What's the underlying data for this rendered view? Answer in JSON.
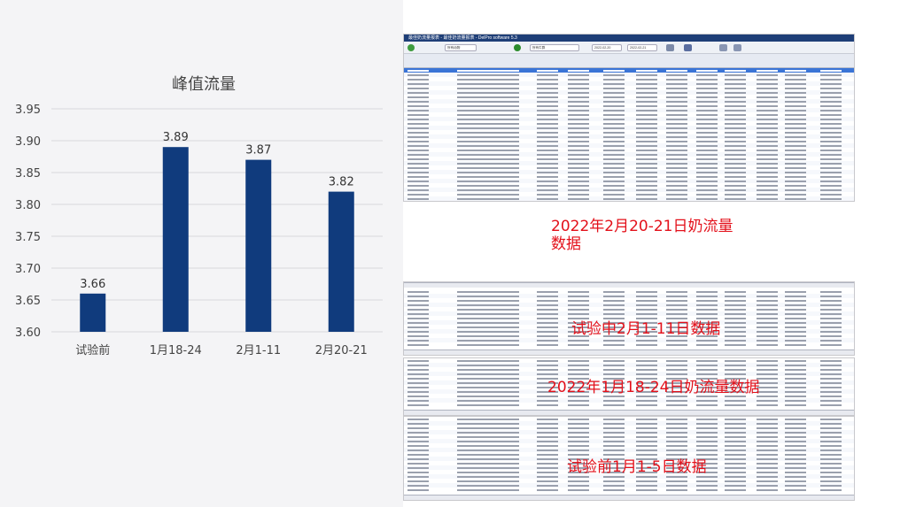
{
  "chart_data": {
    "type": "bar",
    "title": "峰值流量",
    "categories": [
      "试验前",
      "1月18-24",
      "2月1-11",
      "2月20-21"
    ],
    "values": [
      3.66,
      3.89,
      3.87,
      3.82
    ],
    "value_labels": [
      "3.66",
      "3.89",
      "3.87",
      "3.82"
    ],
    "ylim": [
      3.6,
      3.95
    ],
    "yticks": [
      "3.95",
      "3.90",
      "3.85",
      "3.80",
      "3.75",
      "3.70",
      "3.65",
      "3.60"
    ],
    "xlabel": "",
    "ylabel": "",
    "bar_color": "#103b7d",
    "grid": true,
    "legend": "none"
  },
  "screenshot": {
    "title": "最佳奶流量报表 - 最佳奶流量报表 - DelPro software 5.3",
    "toolbar": {
      "filter": "所有动物",
      "group": "所有牛群",
      "date_from": "2022-02-20",
      "date_to": "2022-02-21"
    }
  },
  "annotations": {
    "feb20_21_line1": "2022年2月20-21日奶流量",
    "feb20_21_line2": "数据",
    "feb1_11": "试验中2月1-11日数据",
    "jan18_24": "2022年1月18-24日奶流量数据",
    "before": "试验前1月1-5日数据"
  },
  "colors": {
    "annotation": "#e3101a",
    "grid": "#d7d7dc",
    "selected_row": "#3a74d6"
  }
}
